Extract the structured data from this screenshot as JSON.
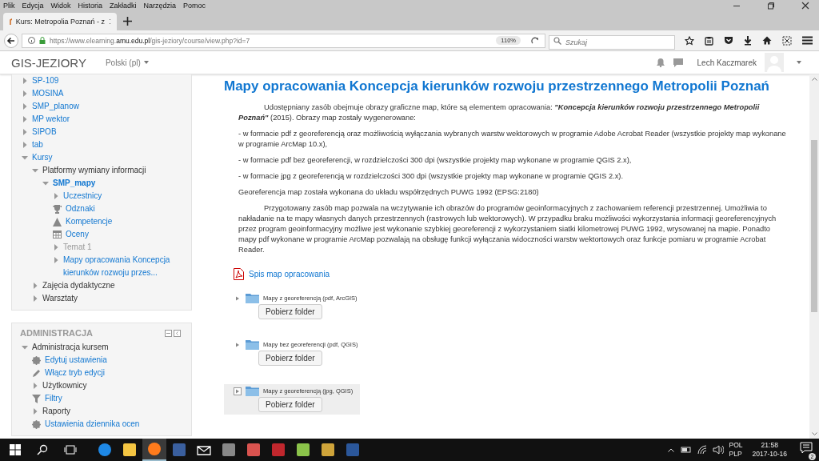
{
  "menu": [
    "Plik",
    "Edycja",
    "Widok",
    "Historia",
    "Zakładki",
    "Narzędzia",
    "Pomoc"
  ],
  "tab": {
    "title": "Kurs: Metropolia Poznań - z"
  },
  "address": {
    "scheme": "https://www.elearning.",
    "domain": "amu.edu.pl",
    "path": "/gis-jeziory/course/view.php?id=7",
    "zoom": "110%"
  },
  "search": {
    "placeholder": "Szukaj"
  },
  "navbar": {
    "brand": "GIS-JEZIORY",
    "language": "Polski (pl)",
    "user": "Lech Kaczmarek"
  },
  "navigation": [
    {
      "label": "SP-109",
      "kind": "branch",
      "link": true,
      "expanded": false
    },
    {
      "label": "MOSINA",
      "kind": "branch",
      "link": true,
      "expanded": false
    },
    {
      "label": "SMP_planow",
      "kind": "branch",
      "link": true,
      "expanded": false
    },
    {
      "label": "MP wektor",
      "kind": "branch",
      "link": true,
      "expanded": false
    },
    {
      "label": "SIPOB",
      "kind": "branch",
      "link": true,
      "expanded": false
    },
    {
      "label": "tab",
      "kind": "branch",
      "link": true,
      "expanded": false
    },
    {
      "label": "Kursy",
      "kind": "branch",
      "link": true,
      "expanded": true,
      "children": [
        {
          "label": "Platformy wymiany informacji",
          "kind": "branch",
          "link": false,
          "expanded": true,
          "children": [
            {
              "label": "SMP_mapy",
              "kind": "branch",
              "link": true,
              "current": true,
              "expanded": true,
              "children": [
                {
                  "label": "Uczestnicy",
                  "kind": "branch",
                  "link": true,
                  "expanded": false
                },
                {
                  "label": "Odznaki",
                  "kind": "trophy",
                  "link": true
                },
                {
                  "label": "Kompetencje",
                  "kind": "competency",
                  "link": true
                },
                {
                  "label": "Oceny",
                  "kind": "grades",
                  "link": true
                },
                {
                  "label": "Temat 1",
                  "kind": "branch",
                  "link": true,
                  "disabled": true,
                  "expanded": false
                },
                {
                  "label": "Mapy opracowania Koncepcja kierunków rozwoju przes...",
                  "kind": "branch",
                  "link": true,
                  "expanded": false
                }
              ]
            }
          ]
        },
        {
          "label": "Zajęcia dydaktyczne",
          "kind": "branch",
          "link": false,
          "expanded": false
        },
        {
          "label": "Warsztaty",
          "kind": "branch",
          "link": false,
          "expanded": false
        }
      ]
    }
  ],
  "administration": {
    "title": "ADMINISTRACJA",
    "items": [
      {
        "label": "Administracja kursem",
        "kind": "branch",
        "link": false,
        "expanded": true,
        "children": [
          {
            "label": "Edytuj ustawienia",
            "kind": "gear",
            "link": true
          },
          {
            "label": "Włącz tryb edycji",
            "kind": "pencil",
            "link": true
          },
          {
            "label": "Użytkownicy",
            "kind": "branch",
            "link": false,
            "expanded": false
          },
          {
            "label": "Filtry",
            "kind": "filter",
            "link": true
          },
          {
            "label": "Raporty",
            "kind": "branch",
            "link": false,
            "expanded": false
          },
          {
            "label": "Ustawienia dziennika ocen",
            "kind": "gear",
            "link": true
          }
        ]
      }
    ]
  },
  "page": {
    "title": "Mapy opracowania Koncepcja kierunków rozwoju przestrzennego Metropolii Poznań",
    "paragraphs": [
      {
        "indent": true,
        "text": "Udostępniany zasób obejmuje obrazy graficzne map, które są elementem opracowania: **\"Koncepcja kierunków rozwoju przestrzennego Metropolii Poznań\"** (2015). Obrazy map zostały wygenerowane:"
      },
      {
        "indent": false,
        "text": "- w formacie pdf z georeferencją oraz możliwością wyłączania wybranych warstw wektorowych w programie Adobe Acrobat Reader (wszystkie projekty map wykonane w programie ArcMap 10.x),"
      },
      {
        "indent": false,
        "text": "- w formacie pdf bez georeferencji, w rozdzielczości 300 dpi (wszystkie projekty map wykonane w programie QGIS 2.x),"
      },
      {
        "indent": false,
        "text": "- w formacie jpg z georeferencją w rozdzielczości 300 dpi (wszystkie projekty map wykonane w programie QGIS 2.x)."
      },
      {
        "indent": false,
        "text": "Georeferencja map została wykonana do układu współrzędnych PUWG 1992 (EPSG:2180)"
      },
      {
        "indent": true,
        "text": "Przygotowany zasób map pozwala na wczytywanie ich obrazów do programów geoinformacyjnych z zachowaniem referencji przestrzennej. Umożliwia to nakładanie na te mapy własnych danych przestrzennych (rastrowych lub wektorowych). W przypadku braku możliwości wykorzystania informacji georeferencyjnych przez program geoinformacyjny możliwe jest wykonanie szybkiej georeferencji z wykorzystaniem siatki kilometrowej PUWG 1992, wrysowanej na mapie. Ponadto mapy pdf wykonane w programie ArcMap pozwalają na obsługę funkcji wyłączania widoczności warstw wektortowych oraz funkcje pomiaru w programie Acrobat Reader."
      }
    ],
    "resource": "Spis map opracowania",
    "folders": [
      {
        "name": "Mapy z georeferencją (pdf, ArcGIS)",
        "button": "Pobierz folder",
        "highlighted": false
      },
      {
        "name": "Mapy bez georeferencji (pdf, QGIS)",
        "button": "Pobierz folder",
        "highlighted": false
      },
      {
        "name": "Mapy z georeferencją (jpg, QGIS)",
        "button": "Pobierz folder",
        "highlighted": true
      }
    ]
  },
  "taskbar": {
    "language": "POL",
    "layout": "PLP",
    "time": "21:58",
    "date": "2017-10-16",
    "notifications": "2"
  }
}
